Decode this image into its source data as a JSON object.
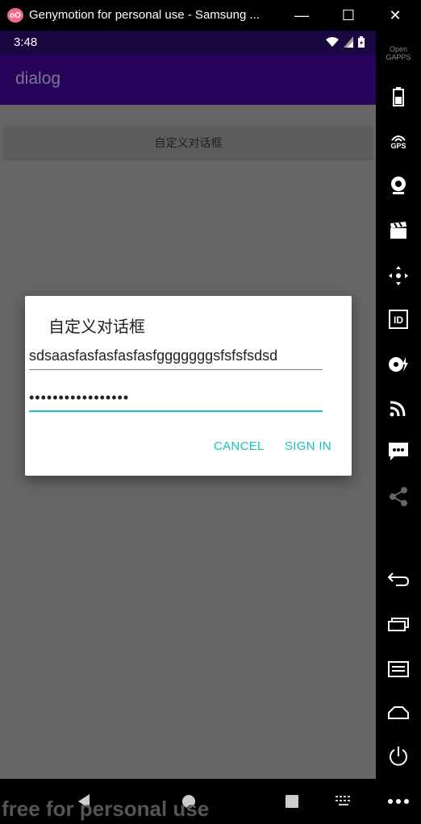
{
  "window": {
    "logo_text": "oO",
    "title": "Genymotion for personal use - Samsung ...",
    "minimize_label": "—",
    "maximize_label": "☐",
    "close_label": "✕"
  },
  "status_bar": {
    "time": "3:48",
    "icons": [
      "wifi-icon",
      "signal-icon",
      "battery-icon"
    ]
  },
  "app_bar": {
    "title": "dialog"
  },
  "main": {
    "open_dialog_button": "自定义对话框"
  },
  "dialog": {
    "title": "自定义对话框",
    "username_value": "sdsaasfasfasfasfasfgggggggsfsfsfsdsd",
    "password_value": "•••••••••••••••••",
    "cancel_label": "CANCEL",
    "signin_label": "SIGN IN"
  },
  "nav_bar": {
    "icons": [
      "back-icon",
      "home-icon",
      "recents-icon",
      "keyboard-icon"
    ]
  },
  "watermark": "free for personal use",
  "sidebar": {
    "opengapps_label": "Open GAPPS",
    "gps_label": "GPS",
    "id_label": "ID",
    "icons": [
      "battery-icon",
      "gps-icon",
      "webcam-icon",
      "video-capture-icon",
      "dpad-icon",
      "device-id-icon",
      "disk-io-icon",
      "cast-icon",
      "sms-icon",
      "share-icon",
      "back-icon",
      "recent-apps-icon",
      "menu-icon",
      "home-icon",
      "power-icon",
      "more-icon"
    ]
  },
  "colors": {
    "status_bar": "#1a0640",
    "app_bar": "#26045a",
    "accent": "#16c2c2",
    "screen_dim": "#666666"
  }
}
